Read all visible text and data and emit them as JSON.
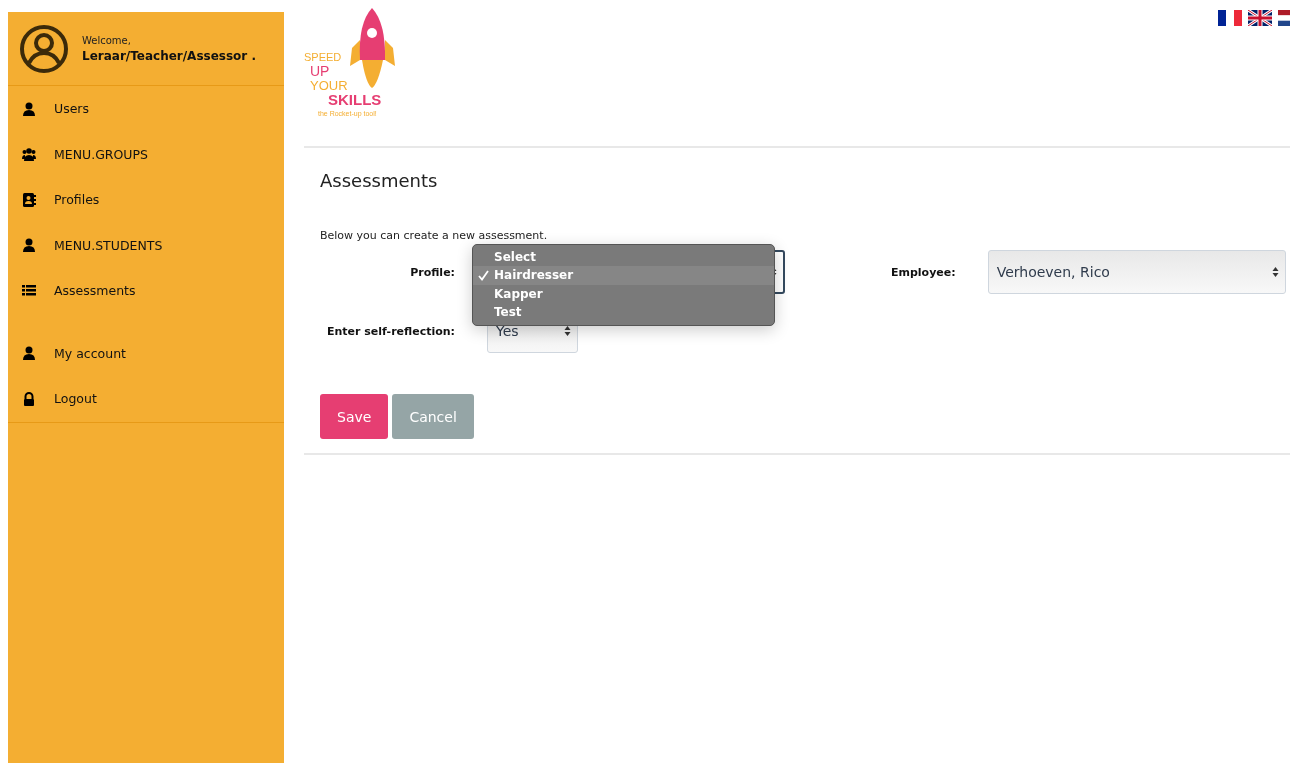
{
  "user": {
    "greeting": "Welcome,",
    "name": "Leraar/Teacher/Assessor ."
  },
  "menu_main": [
    {
      "label": "Users",
      "kind": "user"
    },
    {
      "label": "MENU.GROUPS",
      "kind": "group"
    },
    {
      "label": "Profiles",
      "kind": "contact"
    },
    {
      "label": "MENU.STUDENTS",
      "kind": "user"
    },
    {
      "label": "Assessments",
      "kind": "list"
    }
  ],
  "menu_account": [
    {
      "label": "My account",
      "kind": "user"
    },
    {
      "label": "Logout",
      "kind": "lock"
    }
  ],
  "logo": {
    "line_1": "SPEED",
    "line_2": "UP",
    "line_3": "YOUR",
    "line_4": "SKILLS",
    "tagline": "the Rocket-up tool!"
  },
  "languages": [
    {
      "kind": "fr"
    },
    {
      "kind": "uk"
    },
    {
      "kind": "nl"
    }
  ],
  "page_title": "Assessments",
  "intro": "Below you can create a new assessment.",
  "profile": {
    "label": "Profile:",
    "open": true,
    "options": [
      {
        "label": "Select",
        "selected": false
      },
      {
        "label": "Hairdresser",
        "selected": true
      },
      {
        "label": "Kapper",
        "selected": false
      },
      {
        "label": "Test",
        "selected": false
      }
    ]
  },
  "employee": {
    "label": "Employee:",
    "value": "Verhoeven, Rico"
  },
  "self_reflection": {
    "label": "Enter self-reflection:",
    "value": "Yes"
  },
  "buttons": [
    {
      "label": "Save",
      "kind": "primary"
    },
    {
      "label": "Cancel",
      "kind": "secondary"
    }
  ]
}
